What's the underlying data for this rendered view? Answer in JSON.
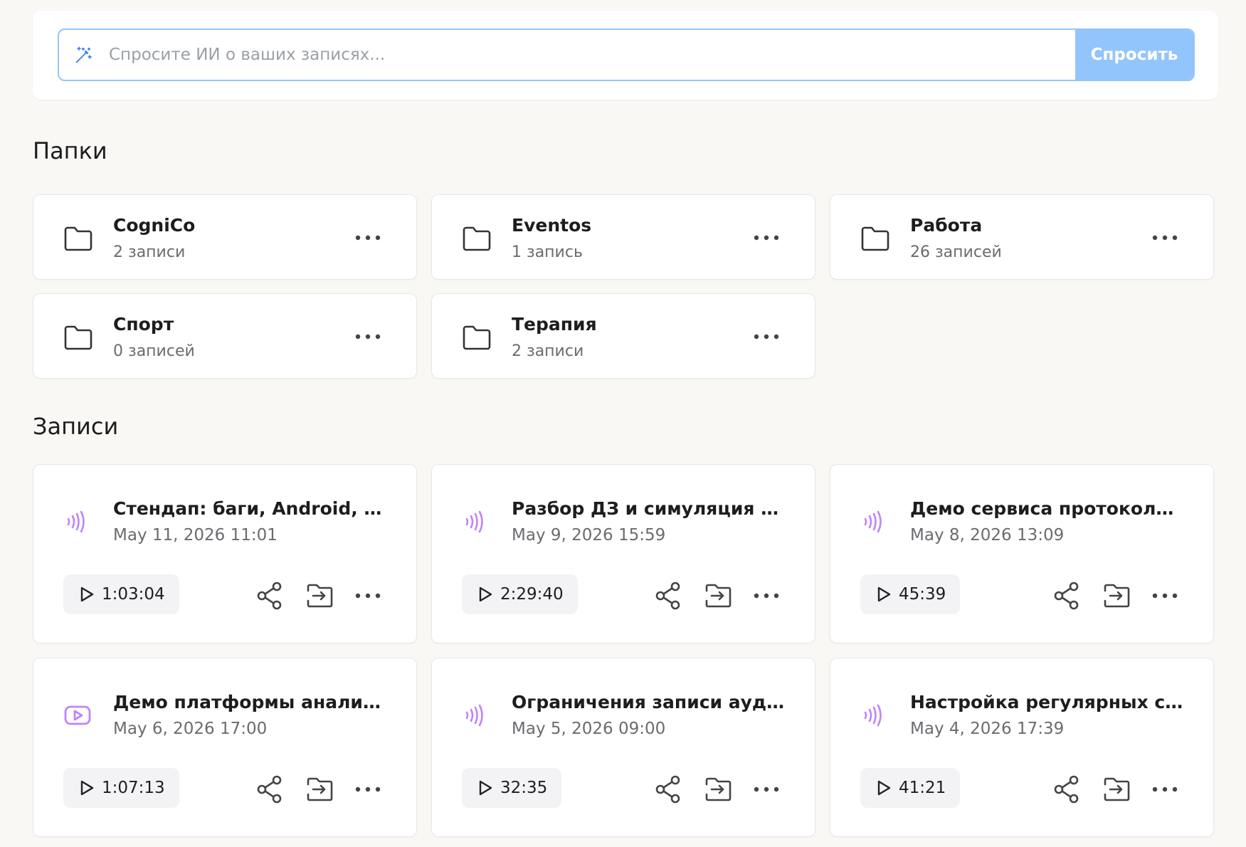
{
  "ask": {
    "placeholder": "Спросите ИИ о ваших записях...",
    "button_label": "Спросить"
  },
  "folders_section": {
    "title": "Папки"
  },
  "folders": [
    {
      "name": "CogniCo",
      "count": "2 записи"
    },
    {
      "name": "Eventos",
      "count": "1 запись"
    },
    {
      "name": "Работа",
      "count": "26 записей"
    },
    {
      "name": "Спорт",
      "count": "0 записей"
    },
    {
      "name": "Терапия",
      "count": "2 записи"
    }
  ],
  "recordings_section": {
    "title": "Записи"
  },
  "recordings": [
    {
      "title": "Стендап: баги, Android, корпоративные задачи",
      "date": "May 11, 2026 11:01",
      "duration": "1:03:04",
      "type": "audio-wave-icon"
    },
    {
      "title": "Разбор ДЗ и симуляция автоматизации",
      "date": "May 9, 2026 15:59",
      "duration": "2:29:40",
      "type": "audio-wave-icon"
    },
    {
      "title": "Демо сервиса протоколирования встреч",
      "date": "May 8, 2026 13:09",
      "duration": "45:39",
      "type": "audio-wave-icon"
    },
    {
      "title": "Демо платформы анализа данных",
      "date": "May 6, 2026 17:00",
      "duration": "1:07:13",
      "type": "video-play-icon"
    },
    {
      "title": "Ограничения записи аудио в браузере",
      "date": "May 5, 2026 09:00",
      "duration": "32:35",
      "type": "audio-wave-icon"
    },
    {
      "title": "Настройка регулярных счетов и оплат",
      "date": "May 4, 2026 17:39",
      "duration": "41:21",
      "type": "audio-wave-icon"
    }
  ],
  "colors": {
    "accent": "#93c5fd",
    "wave_icon": "#c084fc",
    "background": "#f9f8f5"
  }
}
